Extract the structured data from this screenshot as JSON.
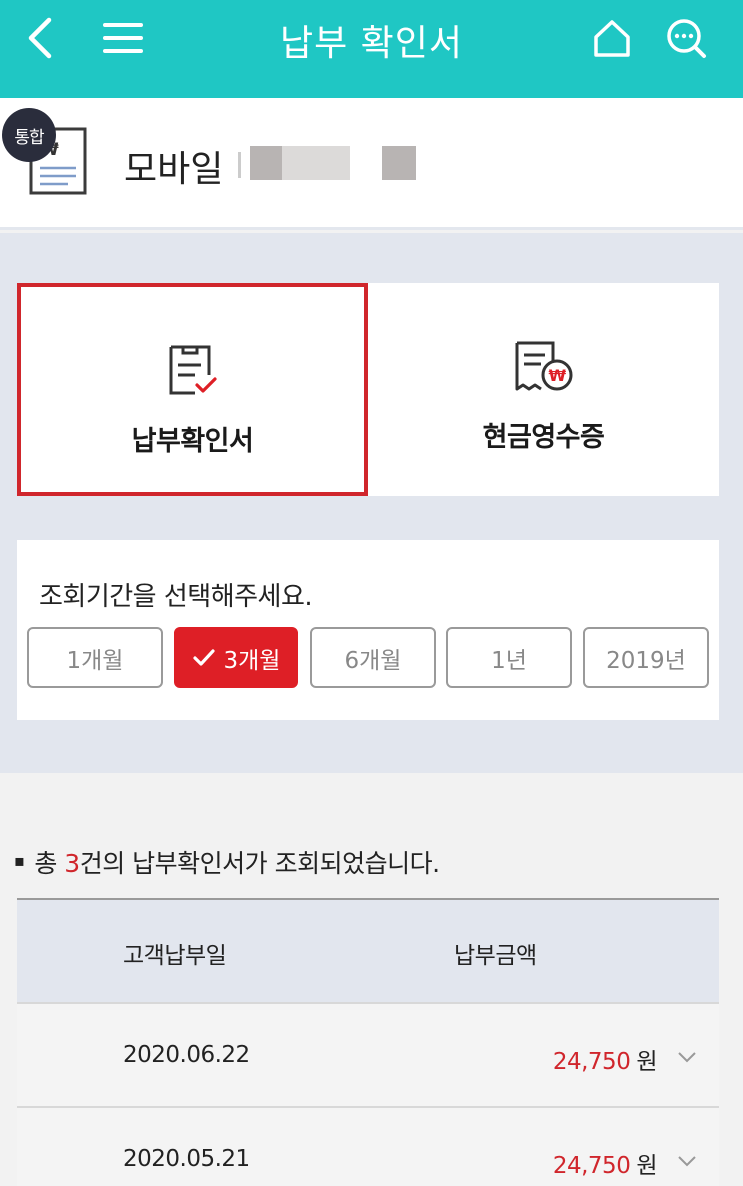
{
  "header": {
    "title": "납부 확인서",
    "icons": [
      "back-icon",
      "menu-icon",
      "home-icon",
      "chat-search-icon"
    ],
    "bg_color": "#1fc7c4"
  },
  "account": {
    "badge": "통합",
    "name": "모바일"
  },
  "tabs": [
    {
      "label": "납부확인서",
      "selected": true
    },
    {
      "label": "현금영수증",
      "selected": false
    }
  ],
  "period": {
    "prompt": "조회기간을 선택해주세요.",
    "options": [
      "1개월",
      "3개월",
      "6개월",
      "1년",
      "2019년"
    ],
    "selected": "3개월"
  },
  "results": {
    "summary_prefix": "총 ",
    "count": "3",
    "summary_suffix": "건의 납부확인서가 조회되었습니다.",
    "columns": [
      "고객납부일",
      "납부금액"
    ],
    "rows": [
      {
        "date": "2020.06.22",
        "amount": "24,750",
        "unit": "원"
      },
      {
        "date": "2020.05.21",
        "amount": "24,750",
        "unit": "원"
      }
    ]
  },
  "colors": {
    "accent_red": "#de1f26",
    "teal": "#1fc7c4"
  }
}
